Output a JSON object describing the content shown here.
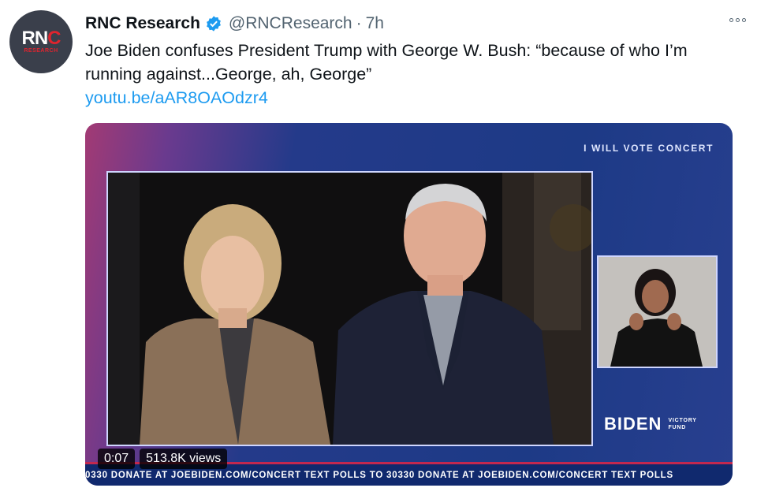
{
  "tweet": {
    "avatar": {
      "logo_left": "RN",
      "logo_accent": "C",
      "logo_sub": "RESEARCH"
    },
    "name": "RNC Research",
    "handle": "@RNCResearch",
    "separator": "·",
    "time": "7h",
    "text": "Joe Biden confuses President Trump with George W. Bush: “because of who I’m running against...George, ah, George”",
    "link": "youtu.be/aAR8OAOdzr4"
  },
  "video": {
    "banner": "I WILL VOTE CONCERT",
    "brand_name": "BIDEN",
    "brand_fund_line1": "VICTORY",
    "brand_fund_line2": "FUND",
    "ticker": "0330   DONATE AT JOEBIDEN.COM/CONCERT    TEXT POLLS TO 30330    DONATE AT JOEBIDEN.COM/CONCERT    TEXT POLLS",
    "time_elapsed": "0:07",
    "views": "513.8K views"
  },
  "colors": {
    "accent": "#1d9bf0",
    "ticker_bg": "#10296e",
    "ticker_stripe": "#c2284f"
  },
  "icons": {
    "verified": "verified-badge-icon",
    "more": "more-options-icon"
  }
}
